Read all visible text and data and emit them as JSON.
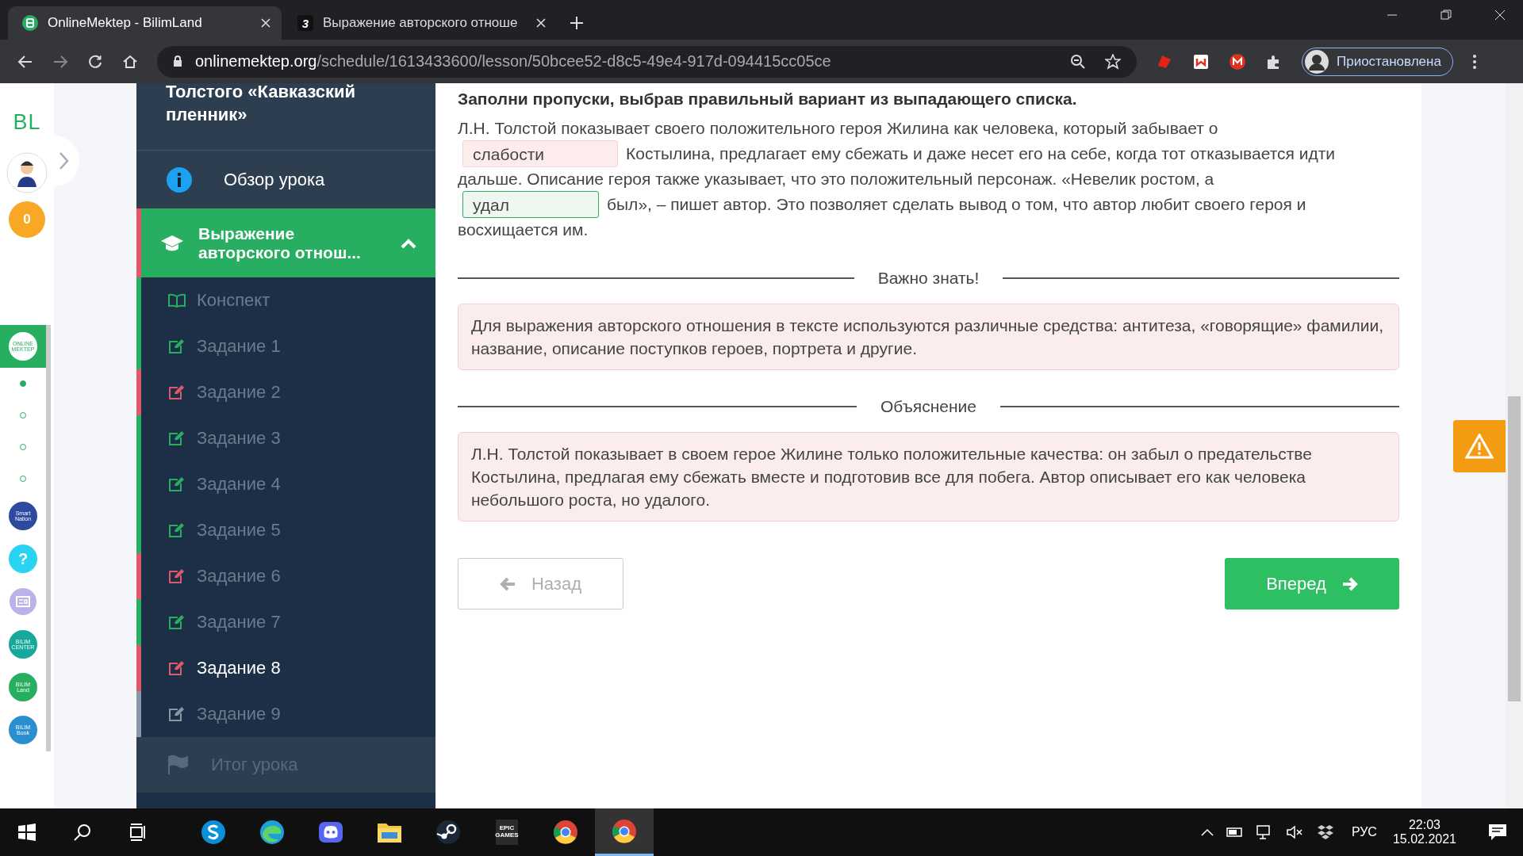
{
  "browser": {
    "tabs": [
      {
        "title": "OnlineMektep - BilimLand",
        "kind": "bilimland",
        "selected": true
      },
      {
        "title": "Выражение авторского отноше",
        "kind": "digit",
        "favicon_text": "3",
        "selected": false
      }
    ],
    "url_host": "onlinemektep.org",
    "url_path": "/schedule/1613433600/lesson/50bcee52-d8c5-49e4-917d-094415cc05ce",
    "profile": "Приостановлена"
  },
  "rail": {
    "logo": "BL",
    "points": "0",
    "apps": [
      {
        "kind": "logo",
        "label": "ONLINE MEKTEP",
        "color": "#27ae60",
        "selected": true
      },
      {
        "kind": "dot",
        "selected": true
      },
      {
        "kind": "dot",
        "selected": false
      },
      {
        "kind": "dot",
        "selected": false
      },
      {
        "kind": "dot",
        "selected": false
      },
      {
        "kind": "logo",
        "label": "Smart Nation",
        "color": "#2e4a9e",
        "selected": false
      },
      {
        "kind": "help",
        "label": "?",
        "color": "#29d3f2",
        "selected": false
      },
      {
        "kind": "news",
        "color": "#b9b3ea",
        "selected": false
      },
      {
        "kind": "logo",
        "label": "BILIM CENTER",
        "color": "#16a89a",
        "selected": false
      },
      {
        "kind": "logo",
        "label": "BILIM Land",
        "color": "#27ae60",
        "selected": false
      },
      {
        "kind": "logo",
        "label": "BILIM Book",
        "color": "#2a8fd0",
        "selected": false
      }
    ]
  },
  "lesson_nav": {
    "title": "Толстого «Кавказский пленник»",
    "overview": "Обзор урока",
    "section": {
      "title": "Выражение авторского отнош...",
      "expanded": true
    },
    "items": [
      {
        "kind": "summary",
        "label": "Конспект",
        "color": "#27ae60",
        "selected": false
      },
      {
        "kind": "task",
        "label": "Задание 1",
        "color": "#27ae60",
        "selected": false
      },
      {
        "kind": "task",
        "label": "Задание 2",
        "color": "#e0596b",
        "selected": false
      },
      {
        "kind": "task",
        "label": "Задание 3",
        "color": "#27ae60",
        "selected": false
      },
      {
        "kind": "task",
        "label": "Задание 4",
        "color": "#27ae60",
        "selected": false
      },
      {
        "kind": "task",
        "label": "Задание 5",
        "color": "#27ae60",
        "selected": false
      },
      {
        "kind": "task",
        "label": "Задание 6",
        "color": "#e0596b",
        "selected": false
      },
      {
        "kind": "task",
        "label": "Задание 7",
        "color": "#27ae60",
        "selected": false
      },
      {
        "kind": "task",
        "label": "Задание 8",
        "color": "#e0596b",
        "selected": true
      },
      {
        "kind": "task",
        "label": "Задание 9",
        "color": "#8a96a3",
        "selected": false
      }
    ],
    "final": "Итог урока"
  },
  "task": {
    "instruction": "Заполни пропуски, выбрав правильный вариант из выпадающего списка.",
    "lines": [
      [
        {
          "kind": "text",
          "text": "Л.Н. Толстой показывает своего положительного героя Жилина как человека, который забывает о"
        }
      ],
      [
        {
          "kind": "blank",
          "value": "слабости",
          "correct": false
        },
        {
          "kind": "text",
          "text": "Костылина, предлагает ему сбежать и даже несет его на себе, когда тот отказывается идти"
        }
      ],
      [
        {
          "kind": "text",
          "text": "дальше. Описание героя также указывает, что это положительный персонаж. «Невелик ростом, а"
        }
      ],
      [
        {
          "kind": "blank",
          "value": "удал",
          "correct": true
        },
        {
          "kind": "text",
          "text": "был», – пишет автор. Это позволяет сделать вывод о том, что автор любит своего героя и"
        }
      ],
      [
        {
          "kind": "text",
          "text": "восхищается им."
        }
      ]
    ]
  },
  "important": {
    "heading": "Важно знать!",
    "text": "Для выражения авторского отношения в тексте используются различные средства: антитеза, «говорящие» фамилии, название, описание поступков героев, портрета и другие."
  },
  "explanation": {
    "heading": "Объяснение",
    "text": "Л.Н. Толстой показывает в своем герое Жилине только положительные качества: он забыл о предательстве Костылина, предлагая ему сбежать вместе и подготовив все для побега. Автор описывает его как человека небольшого роста, но удалого."
  },
  "nav_buttons": {
    "back": {
      "label": "Назад",
      "disabled": true
    },
    "next": {
      "label": "Вперед",
      "disabled": false
    }
  },
  "taskbar": {
    "apps": [
      {
        "kind": "skype",
        "selected": false
      },
      {
        "kind": "edge",
        "selected": false
      },
      {
        "kind": "discord",
        "selected": false
      },
      {
        "kind": "folder",
        "selected": false
      },
      {
        "kind": "steam",
        "selected": false
      },
      {
        "kind": "epic",
        "label": "EPIC GAMES",
        "selected": false
      },
      {
        "kind": "chrome",
        "selected": false
      },
      {
        "kind": "chrome",
        "selected": true
      }
    ],
    "lang": "РУС",
    "time": "22:03",
    "date": "15.02.2021"
  }
}
